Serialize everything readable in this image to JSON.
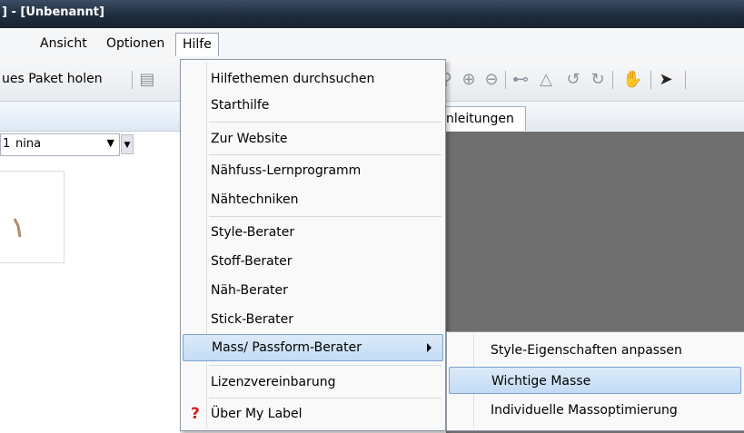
{
  "window": {
    "title": "] - [Unbenannt]"
  },
  "menubar": {
    "items": [
      "Ansicht",
      "Optionen",
      "Hilfe"
    ]
  },
  "toolbar": {
    "package_label": "ues Paket holen"
  },
  "left_panel": {
    "combo_value": "nina",
    "combo_prefix": "1"
  },
  "tabs": {
    "active_label": "nleitungen"
  },
  "hilfe_menu": {
    "items": [
      "Hilfethemen durchsuchen",
      "Starthilfe",
      "Zur Website",
      "Nähfuss-Lernprogramm",
      "Nähtechniken",
      "Style-Berater",
      "Stoff-Berater",
      "Näh-Berater",
      "Stick-Berater",
      "Mass/ Passform-Berater",
      "Lizenzvereinbarung",
      "Über My Label"
    ]
  },
  "submenu": {
    "items": [
      "Style-Eigenschaften anpassen",
      "Wichtige Masse",
      "Individuelle Massoptimierung"
    ]
  },
  "colors": {
    "highlight": "#c3dcf5",
    "titlebar": "#1f2d3e",
    "canvas": "#6f6f6f"
  }
}
